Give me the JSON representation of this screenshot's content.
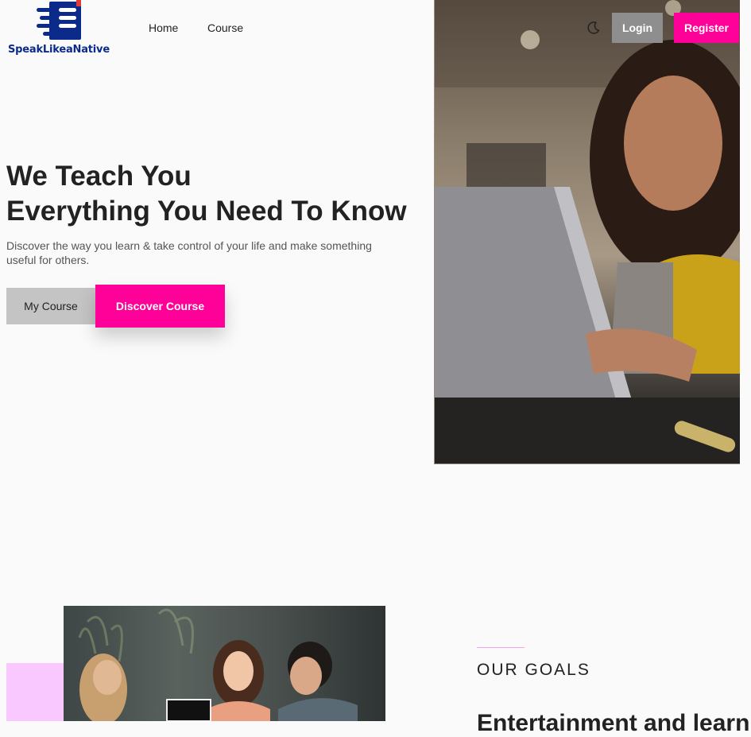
{
  "brand": {
    "name": "SpeakLikeaNative",
    "logo_icon": "book-speed-logo",
    "color": "#0b2a8a"
  },
  "nav": {
    "home": "Home",
    "course": "Course"
  },
  "header": {
    "theme_icon": "moon-icon",
    "login": "Login",
    "register": "Register"
  },
  "hero": {
    "title_line1": "We Teach You",
    "title_line2": "Everything You Need To Know",
    "description": "Discover the way you learn & take control of your life and make something useful for others.",
    "btn_my_course": "My Course",
    "btn_discover": "Discover Course",
    "image": "woman-laptop-photo"
  },
  "goals": {
    "label": "OUR GOALS",
    "heading": "Entertainment and learning",
    "image": "students-laughing-photo"
  },
  "colors": {
    "accent": "#ff0099",
    "muted_button": "#8e8e8e",
    "light_button": "#c4c4c4",
    "pink_block": "#f8c8ff"
  }
}
